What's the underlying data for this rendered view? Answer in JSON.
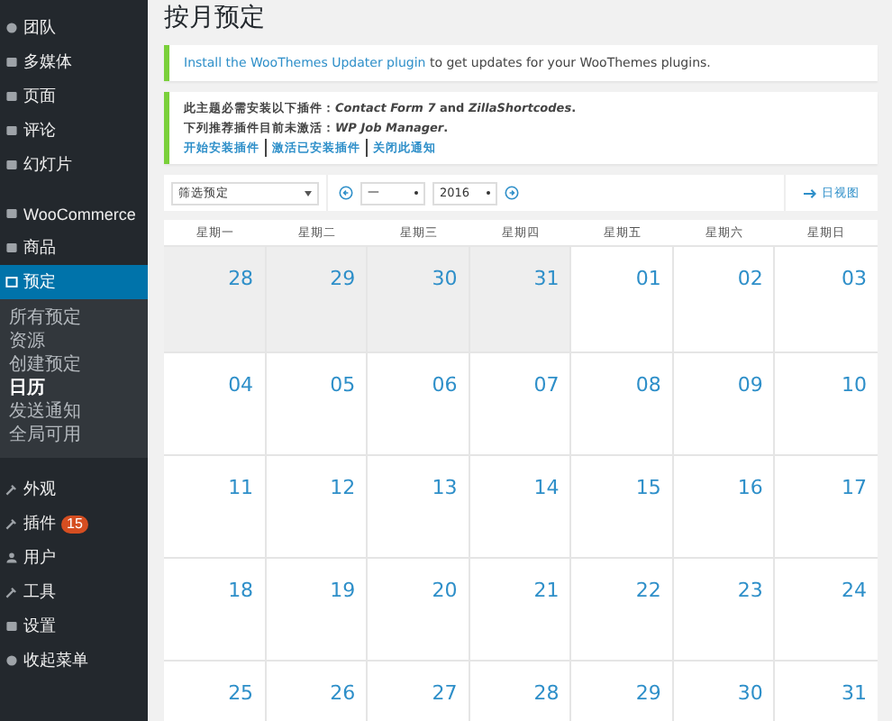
{
  "sidebar": {
    "items": [
      {
        "label": "团队",
        "selected": false
      },
      {
        "label": "多媒体",
        "selected": false
      },
      {
        "label": "页面",
        "selected": false
      },
      {
        "label": "评论",
        "selected": false
      },
      {
        "label": "幻灯片",
        "selected": false
      },
      {
        "label": "WooCommerce",
        "selected": false
      },
      {
        "label": "商品",
        "selected": false
      },
      {
        "label": "预定",
        "selected": true,
        "children": [
          {
            "label": "所有预定",
            "selected": false
          },
          {
            "label": "资源",
            "selected": false
          },
          {
            "label": "创建预定",
            "selected": false
          },
          {
            "label": "日历",
            "selected": true
          },
          {
            "label": "发送通知",
            "selected": false
          },
          {
            "label": "全局可用",
            "selected": false
          }
        ]
      },
      {
        "label": "外观",
        "selected": false
      },
      {
        "label": "插件",
        "selected": false,
        "badge": "15"
      },
      {
        "label": "用户",
        "selected": false
      },
      {
        "label": "工具",
        "selected": false
      },
      {
        "label": "设置",
        "selected": false
      },
      {
        "label": "收起菜单",
        "selected": false
      }
    ]
  },
  "page_title": "按月预定",
  "notice_updater": {
    "link": "Install the WooThemes Updater plugin",
    "text": " to get updates for your WooThemes plugins."
  },
  "notice_plugins": {
    "line_1": "此主题必需安装以下插件：*Contact Form 7* and *ZillaShortcodes*.",
    "line_2": "下列推荐插件目前未激活：*WP Job Manager*.",
    "actions": [
      "开始安装插件",
      "激活已安装插件",
      "关闭此通知"
    ]
  },
  "toolbar": {
    "filter": "筛选预定",
    "month": "一",
    "year": "2016",
    "view_button": "日视图"
  },
  "calendar": {
    "weekdays": [
      "星期一",
      "星期二",
      "星期三",
      "星期四",
      "星期五",
      "星期六",
      "星期日"
    ],
    "weeks": [
      [
        {
          "day": "28",
          "outside_month": true
        },
        {
          "day": "29",
          "outside_month": true
        },
        {
          "day": "30",
          "outside_month": true
        },
        {
          "day": "31",
          "outside_month": true
        },
        {
          "day": "01",
          "outside_month": false
        },
        {
          "day": "02",
          "outside_month": false
        },
        {
          "day": "03",
          "outside_month": false
        }
      ],
      [
        {
          "day": "04",
          "outside_month": false
        },
        {
          "day": "05",
          "outside_month": false
        },
        {
          "day": "06",
          "outside_month": false
        },
        {
          "day": "07",
          "outside_month": false
        },
        {
          "day": "08",
          "outside_month": false
        },
        {
          "day": "09",
          "outside_month": false
        },
        {
          "day": "10",
          "outside_month": false
        }
      ],
      [
        {
          "day": "11",
          "outside_month": false
        },
        {
          "day": "12",
          "outside_month": false
        },
        {
          "day": "13",
          "outside_month": false
        },
        {
          "day": "14",
          "outside_month": false
        },
        {
          "day": "15",
          "outside_month": false
        },
        {
          "day": "16",
          "outside_month": false
        },
        {
          "day": "17",
          "outside_month": false
        }
      ],
      [
        {
          "day": "18",
          "outside_month": false
        },
        {
          "day": "19",
          "outside_month": false
        },
        {
          "day": "20",
          "outside_month": false
        },
        {
          "day": "21",
          "outside_month": false
        },
        {
          "day": "22",
          "outside_month": false
        },
        {
          "day": "23",
          "outside_month": false
        },
        {
          "day": "24",
          "outside_month": false
        }
      ],
      [
        {
          "day": "25",
          "outside_month": false
        },
        {
          "day": "26",
          "outside_month": false
        },
        {
          "day": "27",
          "outside_month": false
        },
        {
          "day": "28",
          "outside_month": false
        },
        {
          "day": "29",
          "outside_month": false
        },
        {
          "day": "30",
          "outside_month": false
        },
        {
          "day": "31",
          "outside_month": false
        }
      ]
    ]
  }
}
